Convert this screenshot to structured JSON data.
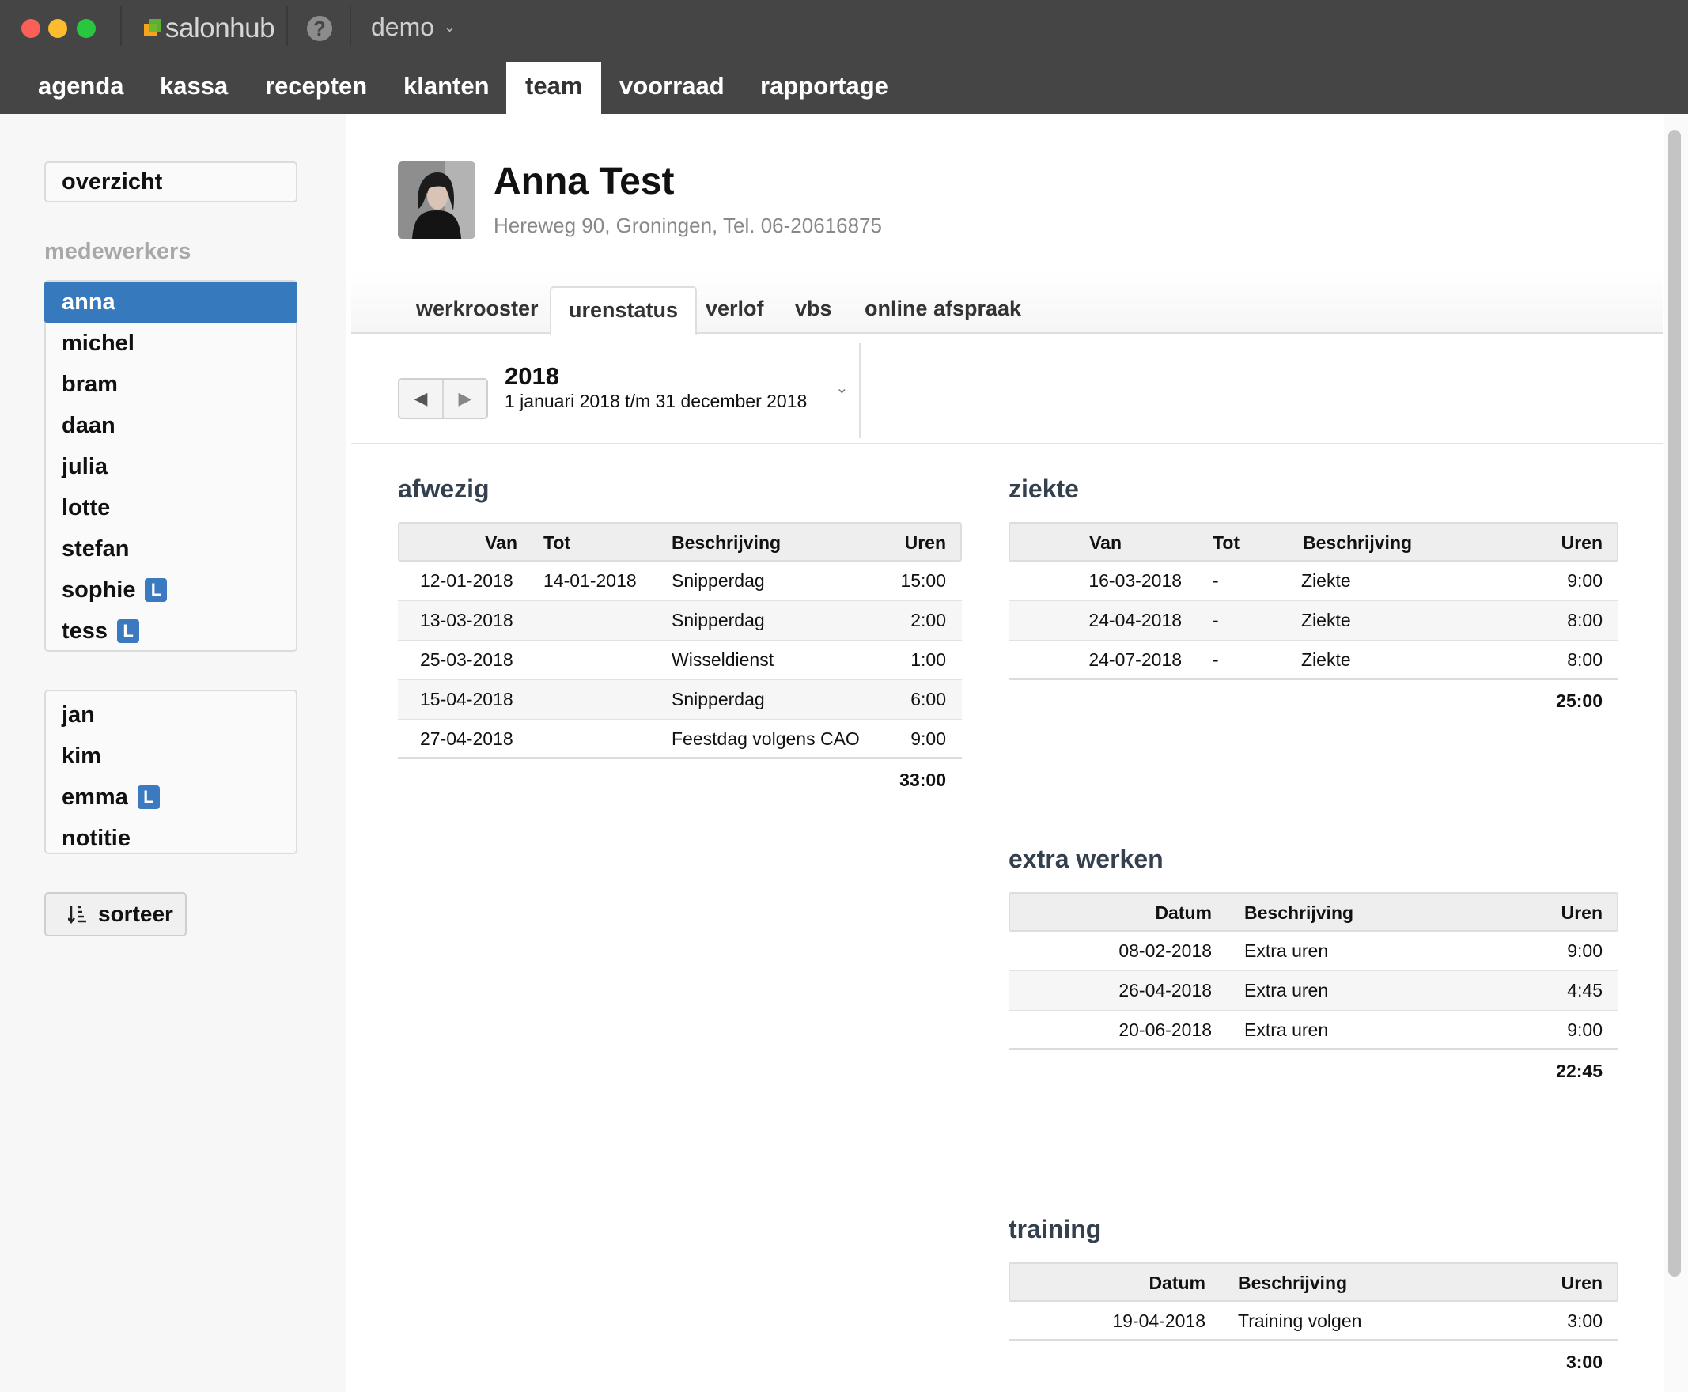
{
  "app": {
    "name": "salonhub",
    "account": "demo"
  },
  "nav": [
    "agenda",
    "kassa",
    "recepten",
    "klanten",
    "team",
    "voorraad",
    "rapportage"
  ],
  "sidebar": {
    "overview": "overzicht",
    "heading": "medewerkers",
    "employees": [
      {
        "name": "anna",
        "badge": ""
      },
      {
        "name": "michel",
        "badge": ""
      },
      {
        "name": "bram",
        "badge": ""
      },
      {
        "name": "daan",
        "badge": ""
      },
      {
        "name": "julia",
        "badge": ""
      },
      {
        "name": "lotte",
        "badge": ""
      },
      {
        "name": "stefan",
        "badge": ""
      },
      {
        "name": "sophie",
        "badge": "L"
      },
      {
        "name": "tess",
        "badge": "L"
      }
    ],
    "others": [
      {
        "name": "jan",
        "badge": ""
      },
      {
        "name": "kim",
        "badge": ""
      },
      {
        "name": "emma",
        "badge": "L"
      },
      {
        "name": "notitie",
        "badge": ""
      }
    ],
    "sort_label": "sorteer"
  },
  "profile": {
    "name": "Anna Test",
    "address": "Hereweg 90, Groningen, Tel. 06-20616875"
  },
  "tabs": [
    "werkrooster",
    "urenstatus",
    "verlof",
    "vbs",
    "online afspraak"
  ],
  "period": {
    "year": "2018",
    "range": "1 januari 2018 t/m 31 december 2018"
  },
  "afwezig": {
    "title": "afwezig",
    "headers": {
      "van": "Van",
      "tot": "Tot",
      "beschrijving": "Beschrijving",
      "uren": "Uren"
    },
    "rows": [
      {
        "van": "12-01-2018",
        "tot": "14-01-2018",
        "beschrijving": "Snipperdag",
        "uren": "15:00"
      },
      {
        "van": "13-03-2018",
        "tot": "",
        "beschrijving": "Snipperdag",
        "uren": "2:00"
      },
      {
        "van": "25-03-2018",
        "tot": "",
        "beschrijving": "Wisseldienst",
        "uren": "1:00"
      },
      {
        "van": "15-04-2018",
        "tot": "",
        "beschrijving": "Snipperdag",
        "uren": "6:00"
      },
      {
        "van": "27-04-2018",
        "tot": "",
        "beschrijving": "Feestdag volgens CAO",
        "uren": "9:00"
      }
    ],
    "total": "33:00"
  },
  "ziekte": {
    "title": "ziekte",
    "headers": {
      "van": "Van",
      "tot": "Tot",
      "beschrijving": "Beschrijving",
      "uren": "Uren"
    },
    "rows": [
      {
        "van": "16-03-2018",
        "tot": "-",
        "beschrijving": "Ziekte",
        "uren": "9:00"
      },
      {
        "van": "24-04-2018",
        "tot": "-",
        "beschrijving": "Ziekte",
        "uren": "8:00"
      },
      {
        "van": "24-07-2018",
        "tot": "-",
        "beschrijving": "Ziekte",
        "uren": "8:00"
      }
    ],
    "total": "25:00"
  },
  "extra": {
    "title": "extra werken",
    "headers": {
      "datum": "Datum",
      "beschrijving": "Beschrijving",
      "uren": "Uren"
    },
    "rows": [
      {
        "datum": "08-02-2018",
        "beschrijving": "Extra uren",
        "uren": "9:00"
      },
      {
        "datum": "26-04-2018",
        "beschrijving": "Extra uren",
        "uren": "4:45"
      },
      {
        "datum": "20-06-2018",
        "beschrijving": "Extra uren",
        "uren": "9:00"
      }
    ],
    "total": "22:45"
  },
  "training": {
    "title": "training",
    "headers": {
      "datum": "Datum",
      "beschrijving": "Beschrijving",
      "uren": "Uren"
    },
    "rows": [
      {
        "datum": "19-04-2018",
        "beschrijving": "Training volgen",
        "uren": "3:00"
      }
    ],
    "total": "3:00"
  }
}
